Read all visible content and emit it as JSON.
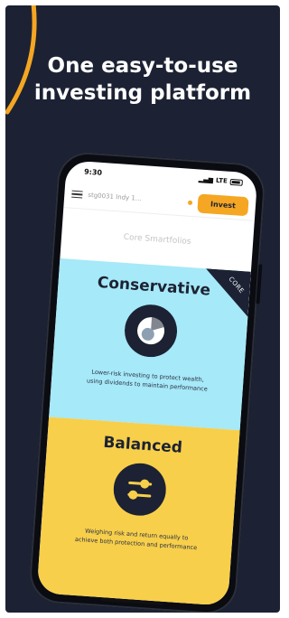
{
  "headline": {
    "line1": "One easy-to-use",
    "line2": "investing platform"
  },
  "status_bar": {
    "time": "9:30",
    "signal": "LTE"
  },
  "app_bar": {
    "account_label": "stg0031 Indy 1...",
    "invest_label": "Invest"
  },
  "section": {
    "title": "Core Smartfolios"
  },
  "cards": [
    {
      "title": "Conservative",
      "ribbon": "CORE",
      "description_line1": "Lower-risk investing to protect wealth,",
      "description_line2": "using dividends to maintain performance",
      "background": "#a6e9f8"
    },
    {
      "title": "Balanced",
      "description_line1": "Weighing risk and return equally to",
      "description_line2": "achieve both protection and performance",
      "background": "#f8cf4a"
    }
  ],
  "colors": {
    "panel": "#1c2233",
    "accent": "#f5a623"
  },
  "icons": [
    "menu-icon",
    "pie-chart-icon",
    "sliders-icon"
  ]
}
